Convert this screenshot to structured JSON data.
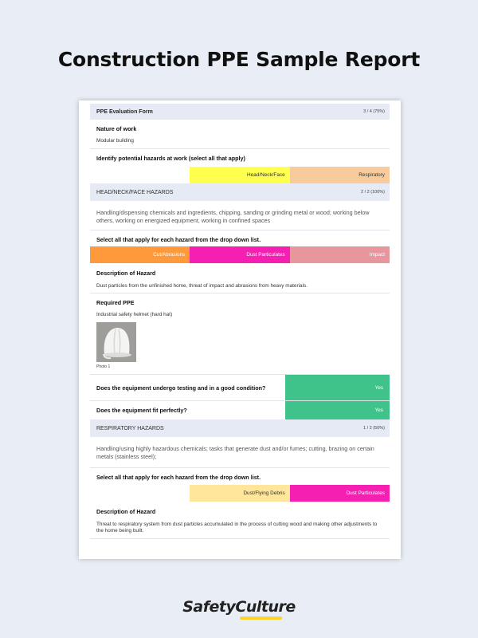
{
  "page": {
    "title": "Construction PPE Sample Report"
  },
  "brand": {
    "name": "SafetyCulture",
    "accent": "#ffd22b"
  },
  "form": {
    "title": "PPE Evaluation Form",
    "score": "3 / 4 (75%)",
    "nature_of_work_label": "Nature of work",
    "nature_of_work_value": "Modular building",
    "hazards_question": "Identify potential hazards at work (select all that apply)",
    "hazards_selected": [
      {
        "label": "Head/Neck/Face",
        "color": "#ffff4d"
      },
      {
        "label": "Respiratory",
        "color": "#f8cb9c"
      }
    ]
  },
  "head_section": {
    "title": "HEAD/NECK/FACE HAZARDS",
    "score": "2 / 2 (100%)",
    "description": "Handling/dispensing chemicals and ingredients, chipping, sanding or grinding metal or wood; working below others, working on energized equipment, working in confined spaces",
    "select_label": "Select all that apply for each hazard from the drop down list.",
    "chips": [
      {
        "label": "Cut/Abrasions",
        "color": "#ff9a3c"
      },
      {
        "label": "Dust Particulates",
        "color": "#f51fb1"
      },
      {
        "label": "Impact",
        "color": "#e8969d"
      }
    ],
    "hazard_desc_label": "Description of Hazard",
    "hazard_desc_value": "Dust particles from the unfinished home, threat of impact and abrasions from heavy materials.",
    "ppe_label": "Required PPE",
    "ppe_value": "Industrial safety helmet (hard hat)",
    "photo_caption": "Photo 1",
    "testing_question": "Does the equipment undergo testing and in a good condition?",
    "testing_answer": "Yes",
    "fit_question": "Does the equipment fit perfectly?",
    "fit_answer": "Yes",
    "yes_color": "#40c38b"
  },
  "resp_section": {
    "title": "RESPIRATORY HAZARDS",
    "score": "1 / 2 (50%)",
    "description": "Handling/using highly hazardous chemicals; tasks that generate dust and/or fumes; cutting, brazing on certain metals (stainless steel);",
    "select_label": "Select all that apply for each hazard from the drop down list.",
    "chips": [
      {
        "label": "Dust/Flying Debris",
        "color": "#ffe69a"
      },
      {
        "label": "Dust Particulates",
        "color": "#f51fb1"
      }
    ],
    "hazard_desc_label": "Description of Hazard",
    "hazard_desc_value": "Threat to respiratory system from dust particles accumulated in the process of cutting wood and making other adjustments to the home being built."
  }
}
